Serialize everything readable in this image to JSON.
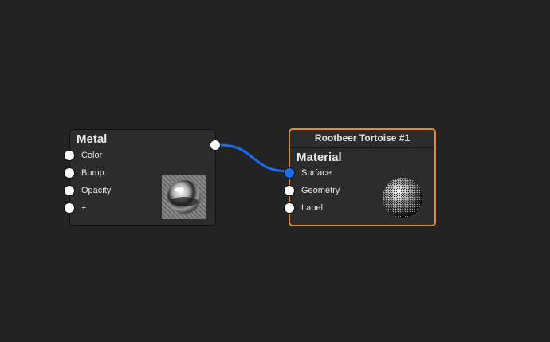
{
  "nodes": {
    "metal": {
      "title": "Metal",
      "inputs": [
        {
          "label": "Color"
        },
        {
          "label": "Bump"
        },
        {
          "label": "Opacity"
        },
        {
          "label": "+"
        }
      ],
      "output_connected": true
    },
    "output": {
      "header": "Rootbeer Tortoise #1",
      "title": "Material",
      "inputs": [
        {
          "label": "Surface",
          "connected": true
        },
        {
          "label": "Geometry",
          "connected": false
        },
        {
          "label": "Label",
          "connected": false
        }
      ]
    }
  },
  "colors": {
    "background": "#232323",
    "node_body": "#2c2c2c",
    "selected_border": "#e08a3c",
    "wire": "#1a6cf0",
    "port": "#ffffff"
  }
}
